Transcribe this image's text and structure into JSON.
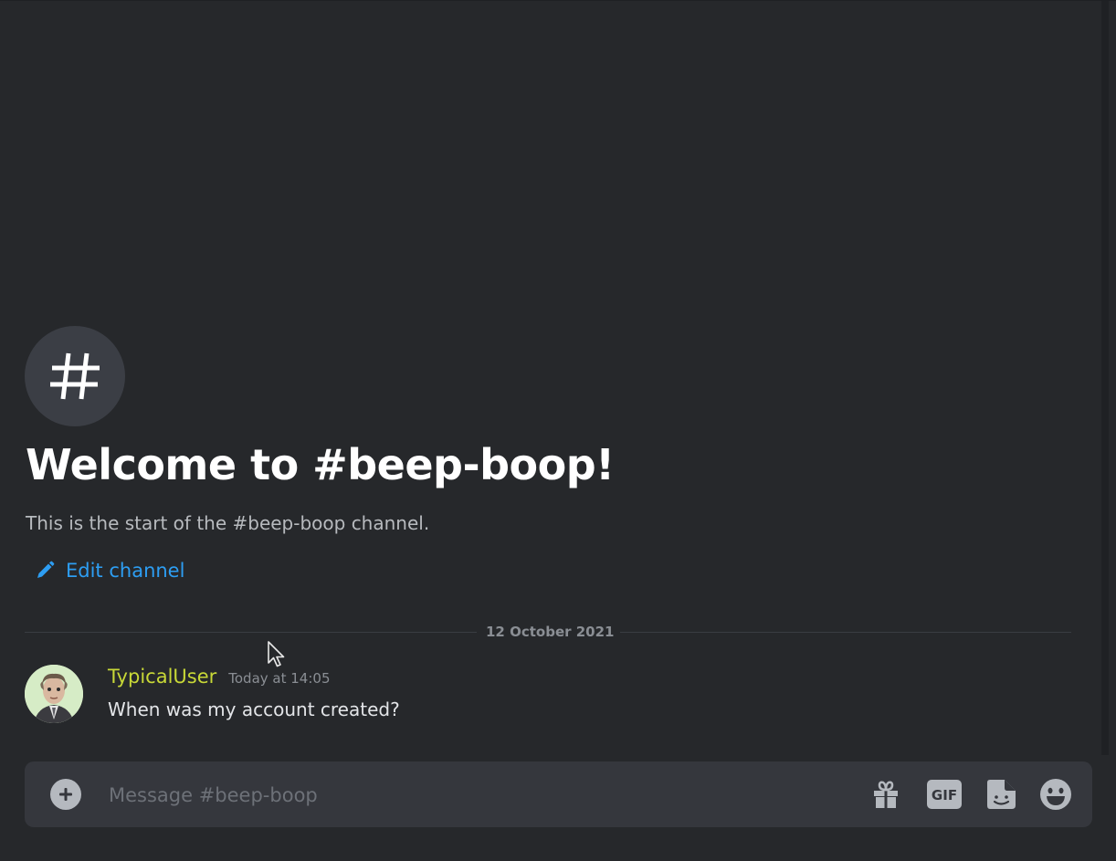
{
  "channel": {
    "icon": "hash-icon",
    "welcome_title": "Welcome to #beep-boop!",
    "welcome_subtitle": "This is the start of the #beep-boop channel.",
    "edit_label": "Edit channel"
  },
  "date_divider": "12 October 2021",
  "messages": [
    {
      "username": "TypicalUser",
      "timestamp": "Today at 14:05",
      "text": "When was my account created?",
      "username_color": "#c8d837"
    }
  ],
  "composer": {
    "placeholder": "Message #beep-boop",
    "gif_label": "GIF",
    "icons": [
      "plus-circle-icon",
      "gift-icon",
      "gif-icon",
      "sticker-icon",
      "emoji-icon"
    ]
  },
  "colors": {
    "background": "#26282b",
    "link": "#2d9ef3",
    "composer": "#35373d"
  }
}
